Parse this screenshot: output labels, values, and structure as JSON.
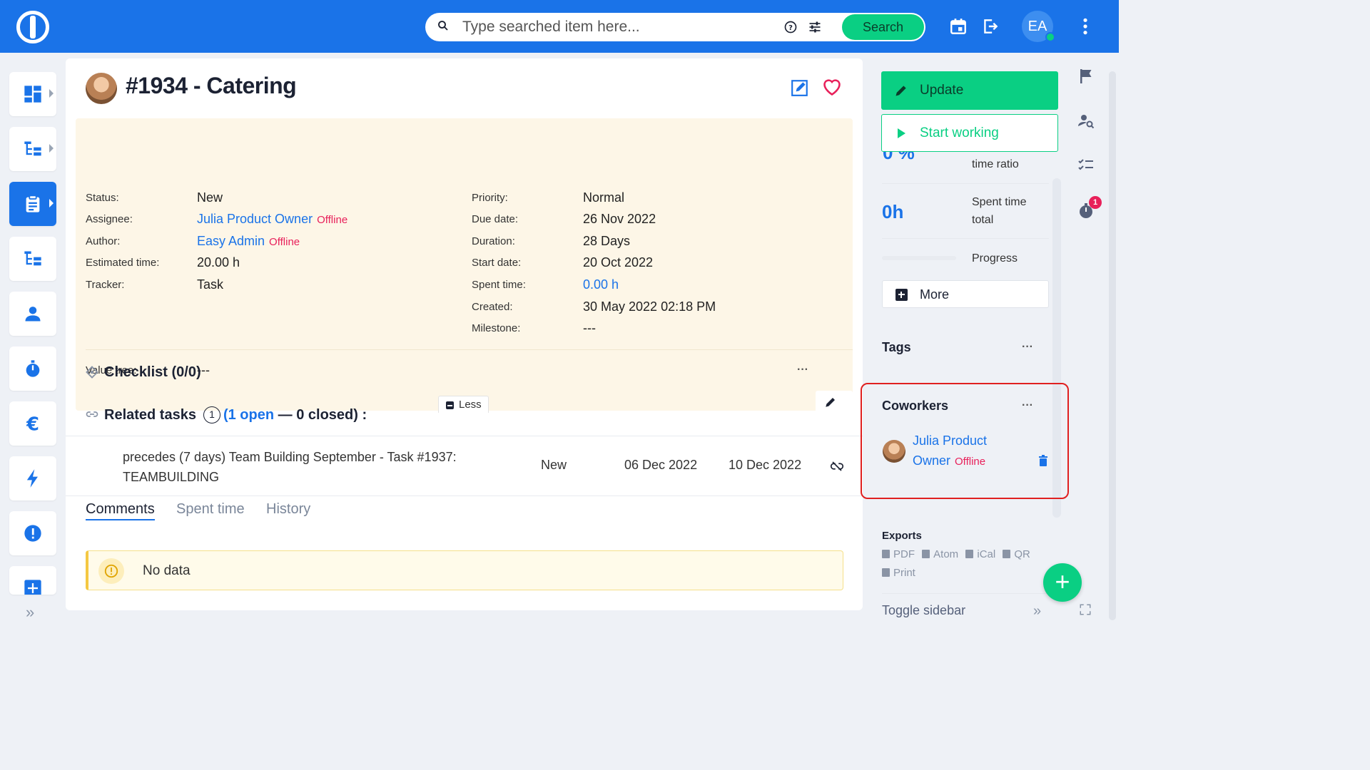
{
  "search": {
    "placeholder": "Type searched item here...",
    "button": "Search"
  },
  "user": {
    "initials": "EA"
  },
  "issue": {
    "title": "#1934 - Catering",
    "labels": {
      "status": "Status:",
      "assignee": "Assignee:",
      "author": "Author:",
      "estimated": "Estimated time:",
      "tracker": "Tracker:",
      "priority": "Priority:",
      "due": "Due date:",
      "duration": "Duration:",
      "start": "Start date:",
      "spent": "Spent time:",
      "created": "Created:",
      "milestone": "Milestone:",
      "value_tree": "Value tree:"
    },
    "values": {
      "status": "New",
      "assignee": "Julia Product Owner",
      "assignee_state": "Offline",
      "author": "Easy Admin",
      "author_state": "Offline",
      "estimated": "20.00 h",
      "tracker": "Task",
      "priority": "Normal",
      "due": "26 Nov 2022",
      "duration": "28 Days",
      "start": "20 Oct 2022",
      "spent": "0.00 h",
      "created": "30 May 2022 02:18 PM",
      "milestone": "---",
      "value_tree": "---"
    },
    "less_label": "Less"
  },
  "checklist": {
    "title": "Checklist (0/0)"
  },
  "related": {
    "title": "Related tasks",
    "count": "1",
    "open_label": "(1 open",
    "closed_label": "— 0 closed) :",
    "row": {
      "description": "precedes (7 days) Team Building September - Task #1937: TEAMBUILDING",
      "status": "New",
      "start": "06 Dec 2022",
      "due": "10 Dec 2022"
    }
  },
  "tabs": [
    {
      "label": "Comments"
    },
    {
      "label": "Spent time"
    },
    {
      "label": "History"
    }
  ],
  "nodata": "No data",
  "sidebar": {
    "update": "Update",
    "start_working": "Start working",
    "ratio_value": "0 %",
    "ratio_label": "time ratio",
    "spent_value": "0h",
    "spent_label_1": "Spent time",
    "spent_label_2": "total",
    "progress_label": "Progress",
    "progress_value": 0,
    "more": "More",
    "tags": "Tags",
    "coworkers": "Coworkers",
    "coworker": {
      "name_1": "Julia Product",
      "name_2": "Owner",
      "state": "Offline"
    },
    "exports_title": "Exports",
    "exports": [
      "PDF",
      "Atom",
      "iCal",
      "QR"
    ],
    "print": "Print",
    "toggle": "Toggle sidebar",
    "timer_badge": "1"
  },
  "colors": {
    "primary": "#1a73e8",
    "accent_green": "#0acf83",
    "offline": "#e8205a",
    "highlight": "#e02020"
  }
}
